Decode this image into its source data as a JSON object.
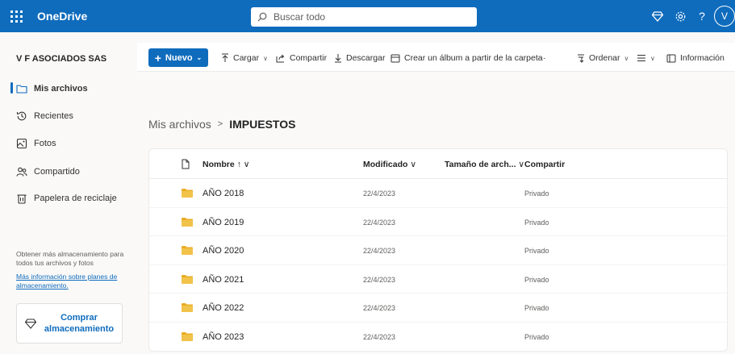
{
  "topbar": {
    "app_name": "OneDrive",
    "search_placeholder": "Buscar todo",
    "help_label": "?",
    "avatar_initial": "V"
  },
  "sidebar": {
    "org_name": "V F ASOCIADOS SAS",
    "items": [
      {
        "label": "Mis archivos",
        "icon": "folder-icon",
        "active": true
      },
      {
        "label": "Recientes",
        "icon": "history-icon",
        "active": false
      },
      {
        "label": "Fotos",
        "icon": "photo-icon",
        "active": false
      },
      {
        "label": "Compartido",
        "icon": "people-icon",
        "active": false
      },
      {
        "label": "Papelera de reciclaje",
        "icon": "trash-icon",
        "active": false
      }
    ],
    "storage_text": "Obtener más almacenamiento para todos tus archivos y fotos",
    "storage_link": "Más información sobre planes de almacenamiento.",
    "buy_button": "Comprar almacenamiento"
  },
  "commandbar": {
    "new": "Nuevo",
    "upload": "Cargar",
    "share": "Compartir",
    "download": "Descargar",
    "create_album": "Crear un álbum a partir de la carpeta",
    "more": "···",
    "sort": "Ordenar",
    "info": "Información"
  },
  "breadcrumb": {
    "parent": "Mis archivos",
    "separator": ">",
    "current": "IMPUESTOS"
  },
  "table": {
    "columns": {
      "name": "Nombre ↑",
      "modified": "Modificado",
      "size": "Tamaño de arch...",
      "sharing": "Compartir"
    },
    "rows": [
      {
        "name": "AÑO 2018",
        "modified": "22/4/2023",
        "sharing": "Privado"
      },
      {
        "name": "AÑO 2019",
        "modified": "22/4/2023",
        "sharing": "Privado"
      },
      {
        "name": "AÑO 2020",
        "modified": "22/4/2023",
        "sharing": "Privado"
      },
      {
        "name": "AÑO 2021",
        "modified": "22/4/2023",
        "sharing": "Privado"
      },
      {
        "name": "AÑO 2022",
        "modified": "22/4/2023",
        "sharing": "Privado"
      },
      {
        "name": "AÑO 2023",
        "modified": "22/4/2023",
        "sharing": "Privado"
      }
    ]
  },
  "colors": {
    "brand": "#0f6cbd",
    "folder": "#f2c34a",
    "folder_dark": "#e8ad25"
  }
}
